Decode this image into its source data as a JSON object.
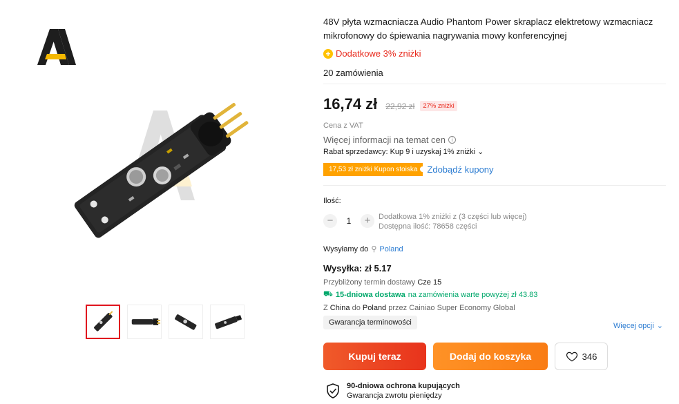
{
  "product": {
    "title": "48V płyta wzmacniacza Audio Phantom Power skraplacz elektretowy wzmacniacz mikrofonowy do śpiewania nagrywania mowy konferencyjnej",
    "promo_label": "Dodatkowe 3% zniżki",
    "orders_text": "20 zamówienia"
  },
  "price": {
    "current": "16,74 zł",
    "original": "22,92 zł",
    "discount": "27% zniżki",
    "vat_note": "Cena z VAT",
    "more_info": "Więcej informacji na temat cen",
    "seller_discount": "Rabat sprzedawcy: Kup 9 i uzyskaj 1% zniżki",
    "coupon": "17,53 zł zniżki Kupon stoiska",
    "coupon_link": "Zdobądź kupony"
  },
  "quantity": {
    "label": "Ilość:",
    "value": "1",
    "note_line1": "Dodatkowa 1% zniżki z (3 części lub więcej)",
    "note_line2": "Dostępna ilość: 78658 części"
  },
  "shipping": {
    "ship_to_label": "Wysyłamy do",
    "country": "Poland",
    "cost": "Wysyłka: zł 5.17",
    "estimate_label": "Przybliżony termin dostawy",
    "estimate_date": "Cze 15",
    "fast_title": "15-dniowa dostawa",
    "fast_rest": "na zamówienia warte powyżej zł 43.83",
    "route_from_label": "Z",
    "route_from": "China",
    "route_to_label": "do",
    "route_to": "Poland",
    "route_via": "przez Cainiao Super Economy Global",
    "guarantee": "Gwarancja terminowości",
    "more_options": "Więcej opcji"
  },
  "actions": {
    "buy_now": "Kupuj teraz",
    "add_to_cart": "Dodaj do koszyka",
    "wishlist_count": "346"
  },
  "protection": {
    "title": "90-dniowa ochrona kupujących",
    "subtitle": "Gwarancja zwrotu pieniędzy"
  },
  "colors": {
    "accent_red": "#e8291c",
    "accent_orange": "#ffa200",
    "link_blue": "#2d7dd2",
    "success_green": "#00a86b"
  },
  "icons": [
    "store-logo-icon",
    "promo-coin-icon",
    "info-icon",
    "chevron-down-icon",
    "minus-icon",
    "plus-icon",
    "location-pin-icon",
    "truck-icon",
    "heart-icon",
    "shield-check-icon"
  ]
}
